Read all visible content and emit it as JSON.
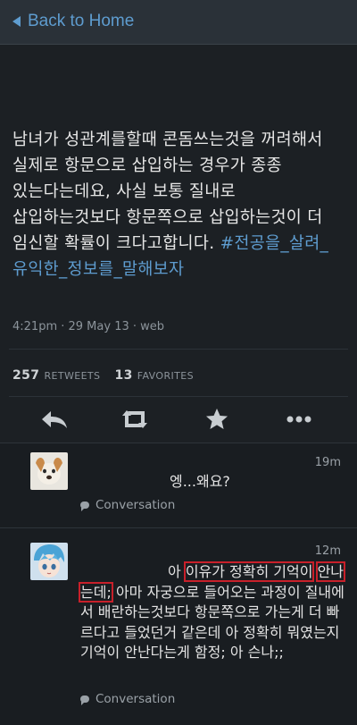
{
  "header": {
    "back_label": "Back to Home"
  },
  "tweet": {
    "text": "남녀가 성관계를할때 콘돔쓰는것을 꺼려해서 실제로 항문으로 삽입하는 경우가 종종 있는다는데요, 사실 보통 질내로 삽입하는것보다 항문쪽으로 삽입하는것이 더 임신할 확률이 크다고합니다. ",
    "hashtag": "#전공을_살려_유익한_정보를_말해보자",
    "meta": "4:21pm · 29 May 13 · web",
    "retweets_count": "257",
    "retweets_label": "RETWEETS",
    "favorites_count": "13",
    "favorites_label": "FAVORITES",
    "actions": [
      "reply-icon",
      "retweet-icon",
      "favorite-icon",
      "more-icon"
    ]
  },
  "replies": [
    {
      "time": "19m",
      "text": "엥...왜요?",
      "conversation_label": "Conversation"
    },
    {
      "time": "12m",
      "text_part1": "아 ",
      "highlight1": "이유가 정확히 기억이",
      "highlight2": "안나는데;",
      "text_part2": "아마 자궁으로 들어오는 과정이 질내에서 배란하는것보다 항문쪽으로 가는게 더 빠르다고 들었던거 같은데 아 정확히 뭐였는지 기억이 안난다는게 함정; 아 슨나;;",
      "conversation_label": "Conversation"
    }
  ],
  "colors": {
    "link": "#5e9ccf",
    "highlight_box": "#c8202a"
  }
}
